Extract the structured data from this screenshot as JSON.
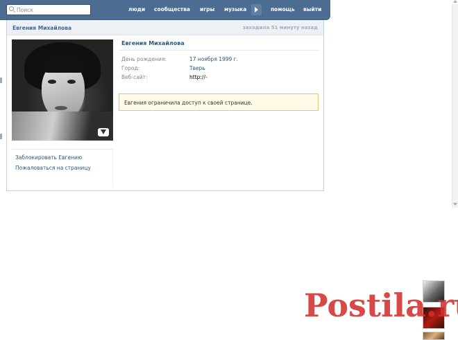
{
  "search": {
    "placeholder": "Поиск"
  },
  "nav": {
    "items": [
      "люди",
      "сообщества",
      "игры",
      "музыка",
      "помощь",
      "выйти"
    ]
  },
  "header": {
    "name": "Евгения Михайлова",
    "last_seen": "заходила 51 минуту назад"
  },
  "profile": {
    "name": "Евгения Михайлова",
    "rows": [
      {
        "label": "День рождения:",
        "value": "17 ноября 1999 г."
      },
      {
        "label": "Город:",
        "value": "Тверь"
      },
      {
        "label": "Веб-сайт:",
        "value": "http://-"
      }
    ],
    "notice": "Евгения ограничила доступ к своей странице."
  },
  "actions": {
    "block": "Заблокировать Евгению",
    "report": "Пожаловаться на страницу"
  },
  "watermark": {
    "text": "Postila.ru"
  },
  "colors": {
    "topbar": "#4c6c91",
    "link": "#2b587a",
    "header_bg": "#edf1f5",
    "notice_bg": "#fffbe6",
    "notice_border": "#e6c86c",
    "watermark": "#d1302c"
  }
}
